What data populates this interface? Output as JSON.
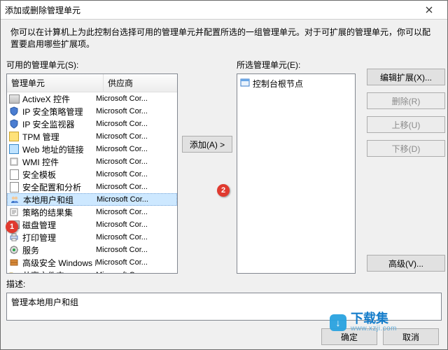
{
  "dialog": {
    "title": "添加或删除管理单元",
    "intro": "你可以在计算机上为此控制台选择可用的管理单元并配置所选的一组管理单元。对于可扩展的管理单元，你可以配置要启用哪些扩展项。"
  },
  "available": {
    "label": "可用的管理单元(S):",
    "columns": {
      "snapin": "管理单元",
      "vendor": "供应商"
    },
    "items": [
      {
        "icon": "activex",
        "name": "ActiveX 控件",
        "vendor": "Microsoft Cor..."
      },
      {
        "icon": "shield",
        "name": "IP 安全策略管理",
        "vendor": "Microsoft Cor..."
      },
      {
        "icon": "shield",
        "name": "IP 安全监视器",
        "vendor": "Microsoft Cor..."
      },
      {
        "icon": "tpm",
        "name": "TPM 管理",
        "vendor": "Microsoft Cor..."
      },
      {
        "icon": "web",
        "name": "Web 地址的链接",
        "vendor": "Microsoft Cor..."
      },
      {
        "icon": "wmi",
        "name": "WMI 控件",
        "vendor": "Microsoft Cor..."
      },
      {
        "icon": "tmpl",
        "name": "安全模板",
        "vendor": "Microsoft Cor..."
      },
      {
        "icon": "analysis",
        "name": "安全配置和分析",
        "vendor": "Microsoft Cor..."
      },
      {
        "icon": "users",
        "name": "本地用户和组",
        "vendor": "Microsoft Cor...",
        "selected": true
      },
      {
        "icon": "policy",
        "name": "策略的结果集",
        "vendor": "Microsoft Cor..."
      },
      {
        "icon": "disk",
        "name": "磁盘管理",
        "vendor": "Microsoft Cor..."
      },
      {
        "icon": "printer",
        "name": "打印管理",
        "vendor": "Microsoft Cor..."
      },
      {
        "icon": "services",
        "name": "服务",
        "vendor": "Microsoft Cor..."
      },
      {
        "icon": "def",
        "name": "高级安全 Windows De...",
        "vendor": "Microsoft Cor..."
      },
      {
        "icon": "folder",
        "name": "共享文件夹",
        "vendor": "Microsoft Cor..."
      }
    ]
  },
  "mid": {
    "add": "添加(A) >"
  },
  "selected": {
    "label": "所选管理单元(E):",
    "root": "控制台根节点"
  },
  "actions": {
    "editExt": "编辑扩展(X)...",
    "remove": "删除(R)",
    "moveUp": "上移(U)",
    "moveDown": "下移(D)",
    "advanced": "高级(V)..."
  },
  "description": {
    "label": "描述:",
    "text": "管理本地用户和组"
  },
  "bottom": {
    "ok": "确定",
    "cancel": "取消"
  },
  "badges": {
    "b1": "1",
    "b2": "2"
  },
  "watermark": {
    "name": "下载集",
    "url": "www.xzji.com"
  }
}
